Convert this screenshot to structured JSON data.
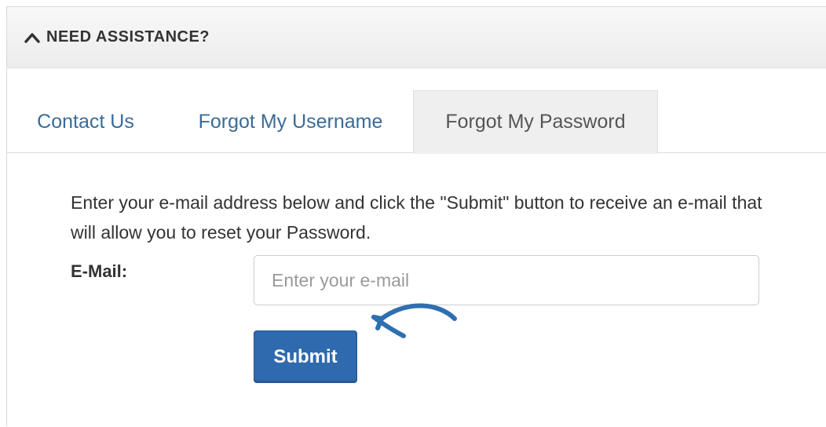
{
  "panel": {
    "title": "NEED ASSISTANCE?",
    "expand_icon": "chevron-up-icon"
  },
  "tabs": [
    {
      "label": "Contact Us",
      "active": false
    },
    {
      "label": "Forgot My Username",
      "active": false
    },
    {
      "label": "Forgot My Password",
      "active": true
    }
  ],
  "form": {
    "instructions": "Enter your e-mail address below and click the \"Submit\" button to receive an e-mail that will allow you to reset your Password.",
    "email_label": "E-Mail:",
    "email_placeholder": "Enter your e-mail",
    "email_value": "",
    "submit_label": "Submit"
  },
  "annotation": {
    "icon": "hand-drawn-arrow-icon",
    "color": "#2f6fb0"
  },
  "colors": {
    "accent": "#2e6aad",
    "link": "#3a6b97"
  }
}
